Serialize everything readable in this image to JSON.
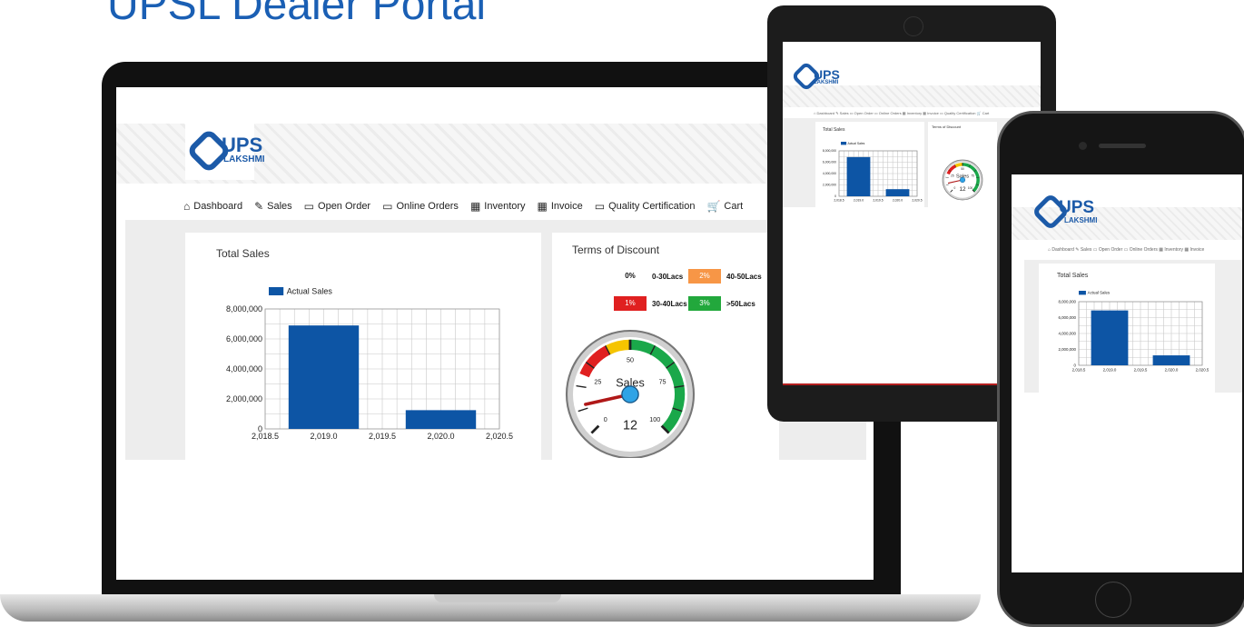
{
  "page_title": "UPSL Dealer Portal",
  "brand": {
    "name": "UPS",
    "sub": "LAKSHMI",
    "color": "#1c5aa8"
  },
  "nav": [
    {
      "icon": "home-icon",
      "glyph": "⌂",
      "label": "Dashboard"
    },
    {
      "icon": "edit-icon",
      "glyph": "✎",
      "label": "Sales"
    },
    {
      "icon": "inbox-icon",
      "glyph": "▭",
      "label": "Open Order"
    },
    {
      "icon": "inbox-icon",
      "glyph": "▭",
      "label": "Online Orders"
    },
    {
      "icon": "grid-icon",
      "glyph": "▦",
      "label": "Inventory"
    },
    {
      "icon": "grid-icon",
      "glyph": "▦",
      "label": "Invoice"
    },
    {
      "icon": "monitor-icon",
      "glyph": "▭",
      "label": "Quality Certification"
    },
    {
      "icon": "cart-icon",
      "glyph": "🛒",
      "label": "Cart"
    }
  ],
  "sales_card": {
    "title": "Total Sales"
  },
  "discount_card": {
    "title": "Terms of Discount",
    "tiers": [
      {
        "badge": "0%",
        "range": "0-30Lacs",
        "color": "#ffffff"
      },
      {
        "badge": "2%",
        "range": "40-50Lacs",
        "color": "#f79646"
      },
      {
        "badge": "1%",
        "range": "30-40Lacs",
        "color": "#e02020"
      },
      {
        "badge": "3%",
        "range": ">50Lacs",
        "color": "#22a83c"
      }
    ]
  },
  "gauge": {
    "label": "Sales",
    "value": 12,
    "min": 0,
    "max": 100,
    "ticks": [
      "0",
      "25",
      "50",
      "75",
      "100"
    ],
    "bands": [
      {
        "from": 25,
        "to": 40,
        "color": "#e02020"
      },
      {
        "from": 40,
        "to": 50,
        "color": "#f5c400"
      },
      {
        "from": 50,
        "to": 100,
        "color": "#1aa84a"
      }
    ]
  },
  "chart_data": {
    "type": "bar",
    "series": [
      {
        "name": "Actual Sales",
        "color": "#0d55a5",
        "x": [
          2019.0,
          2020.0
        ],
        "values": [
          6900000,
          1250000
        ]
      }
    ],
    "xlim": [
      2018.5,
      2020.5
    ],
    "ylim": [
      0,
      8000000
    ],
    "x_ticks": [
      "2,018.5",
      "2,019.0",
      "2,019.5",
      "2,020.0",
      "2,020.5"
    ],
    "y_ticks": [
      "0",
      "2,000,000",
      "4,000,000",
      "6,000,000",
      "8,000,000"
    ],
    "grid": true,
    "legend": "top"
  },
  "tablet": {
    "nav": "⌂ Dashboard  ✎ Sales  ▭ Open Order  ▭ Online Orders  ▦ Inventory  ▦ Invoice  ▭ Quality Certification  🛒 Cart",
    "x_ticks": [
      "2,018.5",
      "2,019.0",
      "2,019.5",
      "2,020.0",
      "2,020.5"
    ],
    "y_ticks": [
      "0",
      "2,000,000",
      "4,000,000",
      "6,000,000",
      "8,000,000"
    ]
  },
  "phone": {
    "nav": "⌂ Dashboard  ✎ Sales  ▭ Open Order  ▭ Online Orders  ▦ Inventory  ▦ Invoice",
    "x_ticks": [
      "2,018.5",
      "2,019.0",
      "2,019.5",
      "2,020.0",
      "2,020.5"
    ],
    "y_ticks": [
      "0",
      "2,000,000",
      "4,000,000",
      "6,000,000",
      "8,000,000"
    ]
  }
}
